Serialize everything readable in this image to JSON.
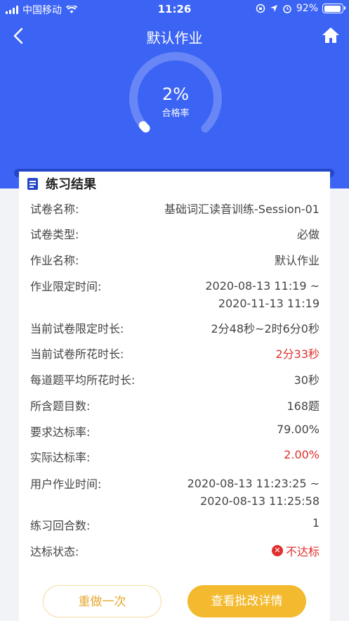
{
  "status": {
    "carrier": "中国移动",
    "time": "11:26",
    "battery": "92%"
  },
  "nav": {
    "title": "默认作业"
  },
  "gauge": {
    "value": "2%",
    "label": "合格率",
    "fraction": 0.02
  },
  "card": {
    "title": "练习结果",
    "rows": [
      {
        "label": "试卷名称:",
        "value": "基础词汇读音训练-Session-01"
      },
      {
        "label": "试卷类型:",
        "value": "必做"
      },
      {
        "label": "作业名称:",
        "value": "默认作业"
      },
      {
        "label": "作业限定时间:",
        "value1": "2020-08-13 11:19 ~",
        "value2": "2020-11-13 11:19"
      },
      {
        "label": "当前试卷限定时长:",
        "value": "2分48秒~2时6分0秒"
      },
      {
        "label": "当前试卷所花时长:",
        "value": "2分33秒"
      },
      {
        "label": "每道题平均所花时长:",
        "value": "30秒"
      },
      {
        "label": "所含题目数:",
        "value": "168题"
      },
      {
        "label": "要求达标率:",
        "value": "79.00%"
      },
      {
        "label": "实际达标率:",
        "value": "2.00%"
      },
      {
        "label": "用户作业时间:",
        "value1": "2020-08-13 11:23:25 ~",
        "value2": "2020-08-13 11:25:58"
      },
      {
        "label": "练习回合数:",
        "value": "1"
      },
      {
        "label": "达标状态:",
        "value": "不达标"
      }
    ]
  },
  "buttons": {
    "redo": "重做一次",
    "detail": "查看批改详情"
  },
  "colors": {
    "header": "#3b63f4",
    "red": "#e0302d",
    "accent": "#f3ba2f"
  }
}
